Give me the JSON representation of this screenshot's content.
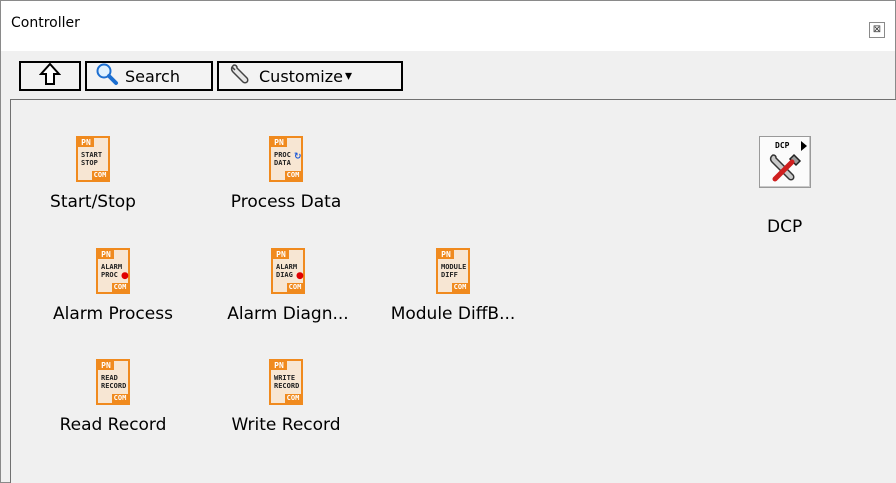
{
  "window": {
    "title": "Controller",
    "close_symbol": "⊠"
  },
  "toolbar": {
    "up_icon": "up-arrow-icon",
    "search_label": "Search",
    "customize_label": "Customize",
    "customize_arrow": "▾"
  },
  "items": [
    {
      "label": "Start/Stop",
      "tag_top": "PN",
      "tag_bottom": "COM",
      "text": "START\nSTOP",
      "mark": ""
    },
    {
      "label": "Process Data",
      "tag_top": "PN",
      "tag_bottom": "COM",
      "text": "PROC\nDATA",
      "mark": "↻"
    },
    {
      "label": "Alarm Process",
      "tag_top": "PN",
      "tag_bottom": "COM",
      "text": "ALARM\nPROC",
      "mark": "●"
    },
    {
      "label": "Alarm Diagn...",
      "tag_top": "PN",
      "tag_bottom": "COM",
      "text": "ALARM\nDIAG",
      "mark": "●"
    },
    {
      "label": "Module DiffB...",
      "tag_top": "PN",
      "tag_bottom": "COM",
      "text": "MODULE\nDIFF",
      "mark": ""
    },
    {
      "label": "Read Record",
      "tag_top": "PN",
      "tag_bottom": "COM",
      "text": "READ\nRECORD",
      "mark": ""
    },
    {
      "label": "Write Record",
      "tag_top": "PN",
      "tag_bottom": "COM",
      "text": "WRITE\nRECORD",
      "mark": ""
    }
  ],
  "dcp": {
    "label": "DCP",
    "icon_text": "DCP"
  }
}
